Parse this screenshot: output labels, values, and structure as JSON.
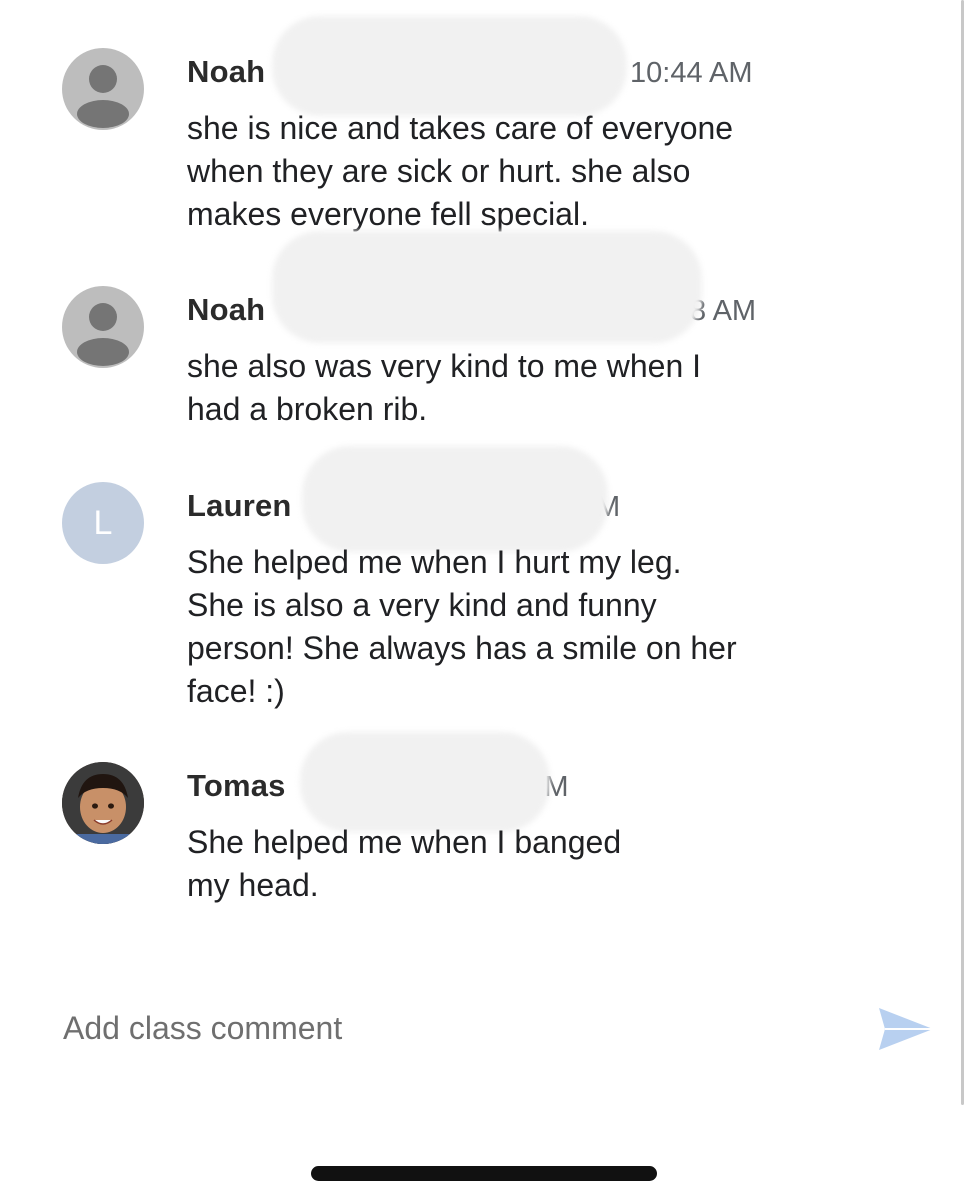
{
  "comments": [
    {
      "author": "Noah",
      "time": "10:44 AM",
      "avatar": {
        "type": "default-person",
        "icon": "person-icon"
      },
      "text": "she is nice and takes care of everyone\nwhen they are sick or hurt. she also\nmakes everyone fell special."
    },
    {
      "author": "Noah",
      "time": "8 AM",
      "avatar": {
        "type": "default-person",
        "icon": "person-icon"
      },
      "text": "she also was very kind to me when I\nhad a broken rib."
    },
    {
      "author": "Lauren",
      "time": "M",
      "avatar": {
        "type": "letter",
        "letter": "L"
      },
      "text": "She helped me when I hurt my leg.\nShe is also a very kind and funny\nperson! She always has a smile on her\nface! :)"
    },
    {
      "author": "Tomas",
      "time": "PM",
      "avatar": {
        "type": "photo",
        "icon": "child-photo-avatar"
      },
      "text": "She helped me when I banged\nmy head."
    }
  ],
  "composer": {
    "placeholder": "Add class comment",
    "send_icon": "send-icon",
    "send_color": "#b8d0f0"
  }
}
